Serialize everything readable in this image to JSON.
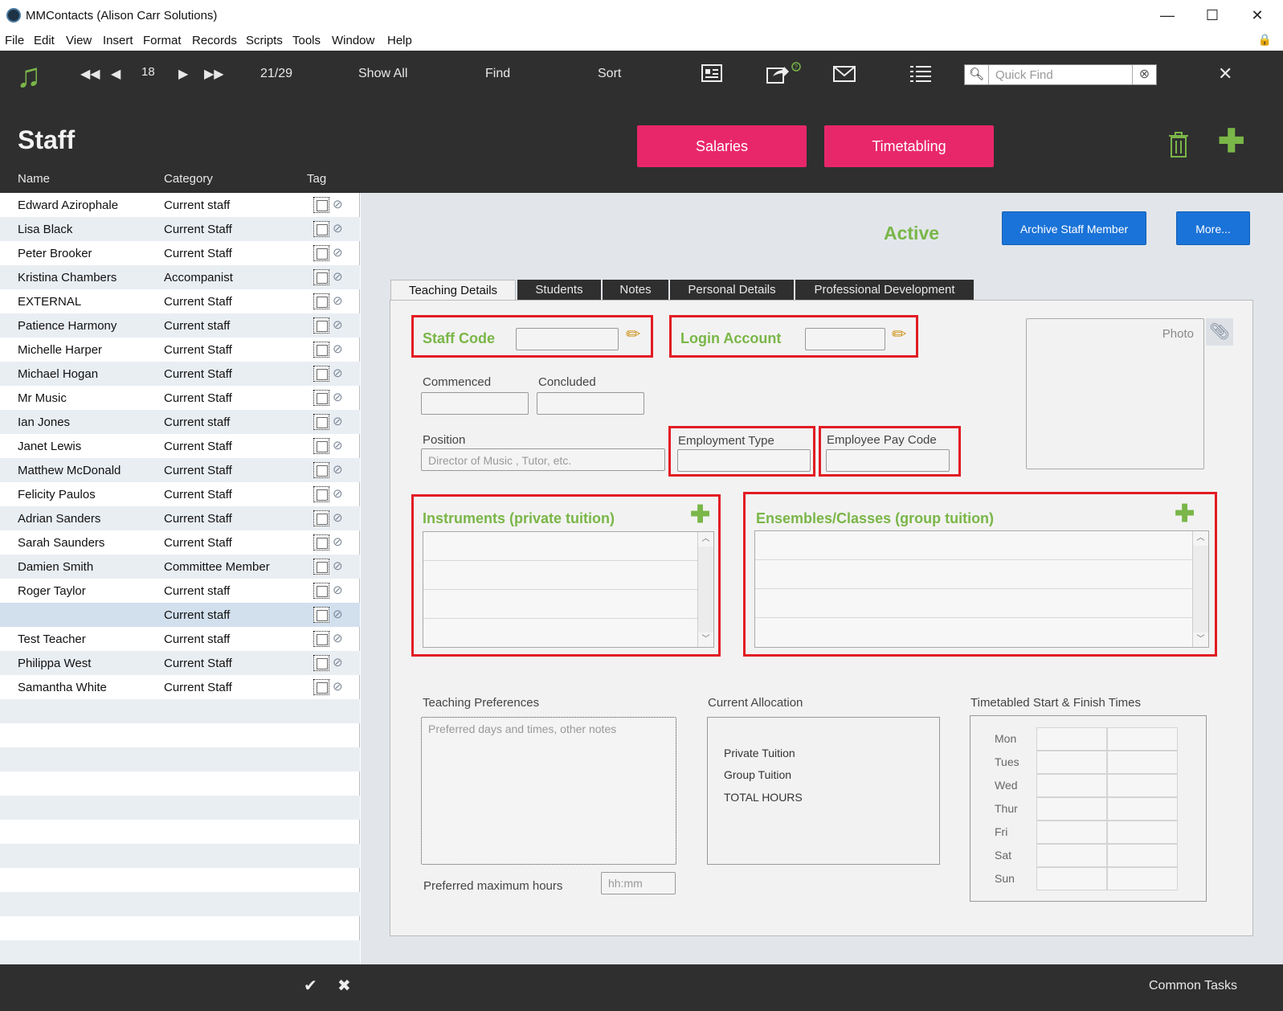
{
  "window": {
    "title": "MMContacts (Alison Carr Solutions)",
    "minimize": "—",
    "maximize": "☐",
    "close": "✕"
  },
  "menu": [
    "File",
    "Edit",
    "View",
    "Insert",
    "Format",
    "Records",
    "Scripts",
    "Tools",
    "Window",
    "Help"
  ],
  "toolbar": {
    "record_number": "18",
    "record_count": "21/29",
    "show_all": "Show All",
    "find": "Find",
    "sort": "Sort",
    "quick_find_placeholder": "Quick Find"
  },
  "header": {
    "title": "Staff",
    "salaries": "Salaries",
    "timetabling": "Timetabling",
    "col_name": "Name",
    "col_category": "Category",
    "col_tag": "Tag"
  },
  "staff": [
    {
      "name": "Edward Azirophale",
      "category": "Current staff"
    },
    {
      "name": "Lisa Black",
      "category": "Current Staff"
    },
    {
      "name": "Peter Brooker",
      "category": "Current Staff"
    },
    {
      "name": "Kristina Chambers",
      "category": "Accompanist"
    },
    {
      "name": " EXTERNAL",
      "category": "Current Staff"
    },
    {
      "name": "Patience Harmony",
      "category": "Current staff"
    },
    {
      "name": "Michelle Harper",
      "category": "Current Staff"
    },
    {
      "name": "Michael Hogan",
      "category": "Current Staff"
    },
    {
      "name": "Mr Music",
      "category": "Current Staff"
    },
    {
      "name": "Ian Jones",
      "category": "Current staff"
    },
    {
      "name": "Janet Lewis",
      "category": "Current Staff"
    },
    {
      "name": "Matthew McDonald",
      "category": "Current Staff"
    },
    {
      "name": "Felicity Paulos",
      "category": "Current Staff"
    },
    {
      "name": "Adrian Sanders",
      "category": "Current Staff"
    },
    {
      "name": "Sarah Saunders",
      "category": "Current Staff"
    },
    {
      "name": "Damien Smith",
      "category": "Committee Member"
    },
    {
      "name": "Roger Taylor",
      "category": "Current staff"
    },
    {
      "name": "",
      "category": "Current staff",
      "selected": true
    },
    {
      "name": "Test Teacher",
      "category": "Current staff"
    },
    {
      "name": "Philippa West",
      "category": "Current Staff"
    },
    {
      "name": "Samantha White",
      "category": "Current Staff"
    }
  ],
  "detail": {
    "status": "Active",
    "archive_btn": "Archive Staff Member",
    "more_btn": "More...",
    "tabs": [
      "Teaching Details",
      "Students",
      "Notes",
      "Personal Details",
      "Professional Development"
    ],
    "staff_code": "Staff Code",
    "login_account": "Login Account",
    "commenced": "Commenced",
    "concluded": "Concluded",
    "position": "Position",
    "position_placeholder": "Director of Music , Tutor, etc.",
    "employment_type": "Employment Type",
    "employee_pay_code": "Employee Pay Code",
    "photo": "Photo",
    "instruments": "Instruments (private tuition)",
    "ensembles": "Ensembles/Classes (group tuition)",
    "teaching_prefs": "Teaching Preferences",
    "teaching_prefs_placeholder": "Preferred days and times, other notes",
    "preferred_max_hours": "Preferred maximum hours",
    "hours_placeholder": "hh:mm",
    "current_allocation": "Current Allocation",
    "alloc_items": [
      "Private Tuition",
      "Group Tuition",
      "TOTAL HOURS"
    ],
    "timetabled": "Timetabled Start & Finish Times",
    "days": [
      "Mon",
      "Tues",
      "Wed",
      "Thur",
      "Fri",
      "Sat",
      "Sun"
    ]
  },
  "footer": {
    "common_tasks": "Common Tasks"
  },
  "colors": {
    "accent_green": "#7ab648",
    "pink": "#e8276a",
    "blue": "#1a73d8",
    "dark": "#2f2f2f",
    "highlight_red": "#e21c23"
  }
}
